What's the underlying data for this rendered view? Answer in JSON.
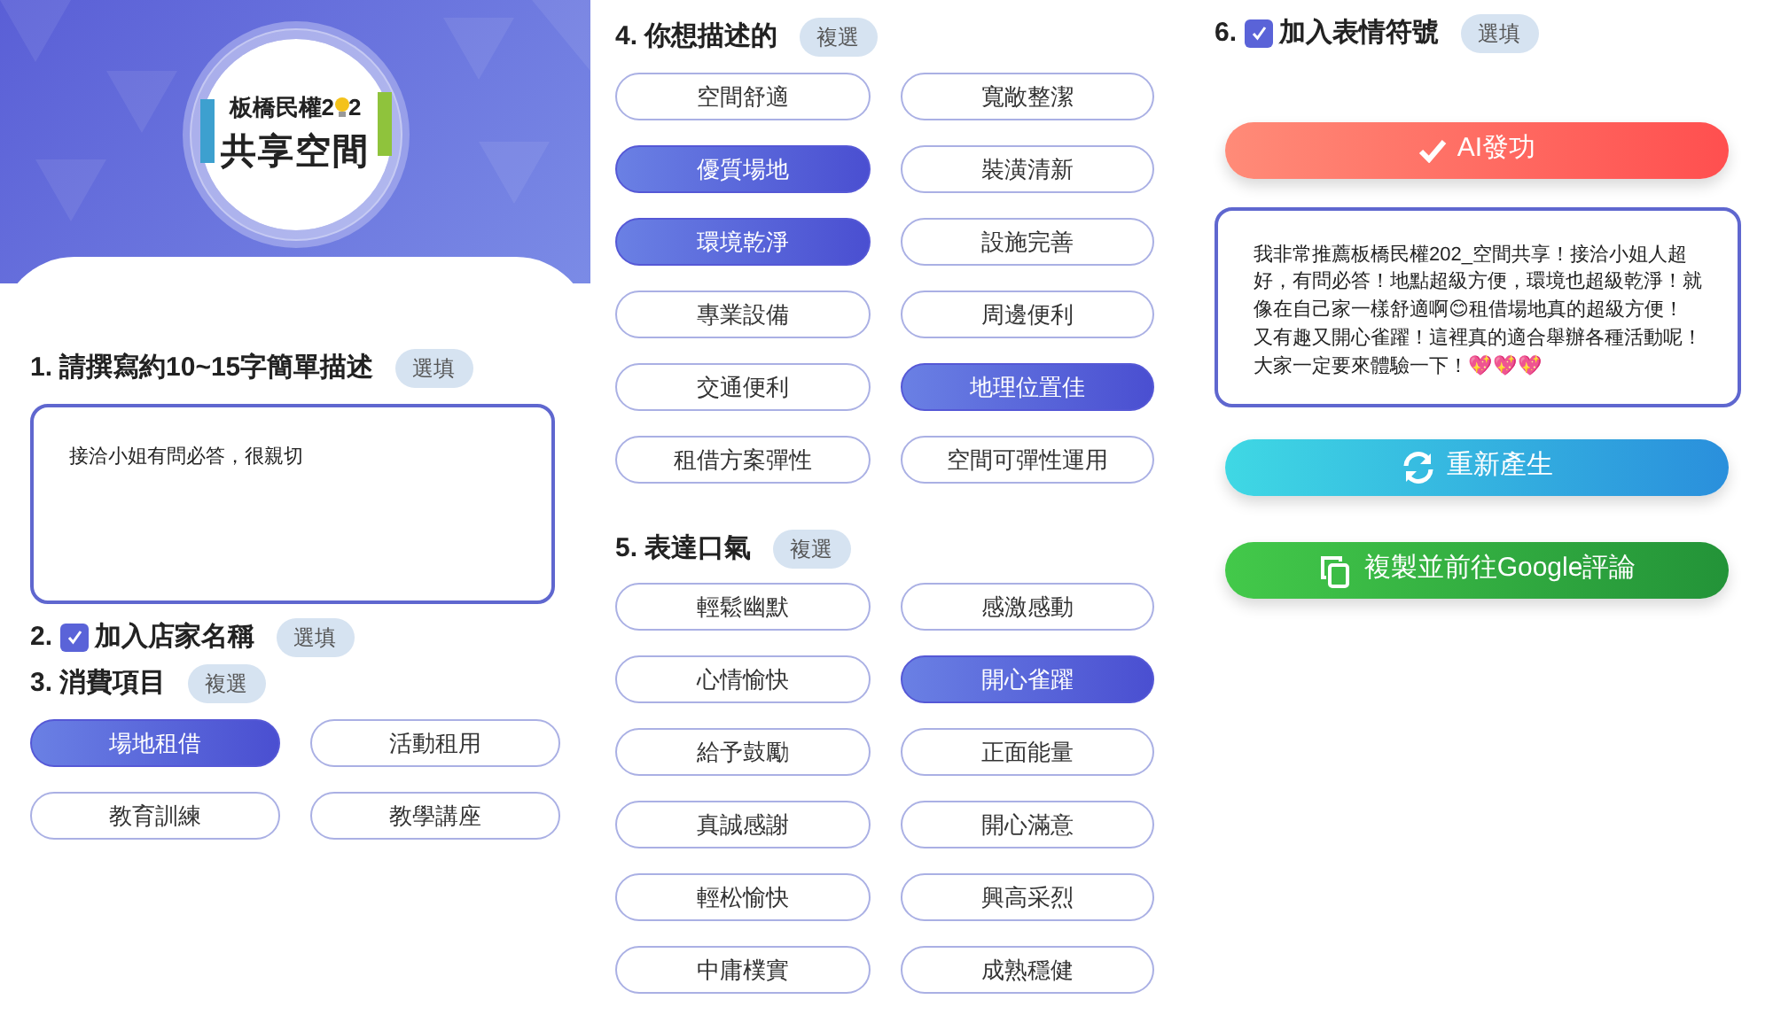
{
  "logo": {
    "prefix": "板橋民權2",
    "suffix": "2",
    "title": "共享空間"
  },
  "description": {
    "number": "1.",
    "title": "請撰寫約10~15字簡單描述",
    "badge": "選填",
    "value": "接洽小姐有問必答，很親切"
  },
  "store_name": {
    "number": "2.",
    "checked": true,
    "title": "加入店家名稱",
    "badge": "選填"
  },
  "items": {
    "number": "3.",
    "title": "消費項目",
    "badge": "複選",
    "options": [
      {
        "label": "場地租借",
        "selected": true
      },
      {
        "label": "活動租用",
        "selected": false
      },
      {
        "label": "教育訓練",
        "selected": false
      },
      {
        "label": "教學講座",
        "selected": false
      }
    ]
  },
  "describe": {
    "number": "4.",
    "title": "你想描述的",
    "badge": "複選",
    "options": [
      {
        "label": "空間舒適",
        "selected": false
      },
      {
        "label": "寬敞整潔",
        "selected": false
      },
      {
        "label": "優質場地",
        "selected": true
      },
      {
        "label": "裝潢清新",
        "selected": false
      },
      {
        "label": "環境乾淨",
        "selected": true
      },
      {
        "label": "設施完善",
        "selected": false
      },
      {
        "label": "專業設備",
        "selected": false
      },
      {
        "label": "周邊便利",
        "selected": false
      },
      {
        "label": "交通便利",
        "selected": false
      },
      {
        "label": "地理位置佳",
        "selected": true
      },
      {
        "label": "租借方案彈性",
        "selected": false
      },
      {
        "label": "空間可彈性運用",
        "selected": false
      }
    ]
  },
  "tone": {
    "number": "5.",
    "title": "表達口氣",
    "badge": "複選",
    "options": [
      {
        "label": "輕鬆幽默",
        "selected": false
      },
      {
        "label": "感激感動",
        "selected": false
      },
      {
        "label": "心情愉快",
        "selected": false
      },
      {
        "label": "開心雀躍",
        "selected": true
      },
      {
        "label": "給予鼓勵",
        "selected": false
      },
      {
        "label": "正面能量",
        "selected": false
      },
      {
        "label": "真誠感謝",
        "selected": false
      },
      {
        "label": "開心滿意",
        "selected": false
      },
      {
        "label": "輕松愉快",
        "selected": false
      },
      {
        "label": "興高采烈",
        "selected": false
      },
      {
        "label": "中庸樸實",
        "selected": false
      },
      {
        "label": "成熟穩健",
        "selected": false
      }
    ]
  },
  "emoji": {
    "number": "6.",
    "checked": true,
    "title": "加入表情符號",
    "badge": "選填"
  },
  "generate_button": "AI發功",
  "result": "我非常推薦板橋民權202_空間共享！接洽小姐人超好，有問必答！地點超級方便，環境也超級乾淨！就像在自己家一樣舒適啊😊租借場地真的超級方便！又有趣又開心雀躍！這裡真的適合舉辦各種活動呢！大家一定要來體驗一下！💖💖💖",
  "regenerate_button": "重新產生",
  "copy_button": "複製並前往Google評論"
}
